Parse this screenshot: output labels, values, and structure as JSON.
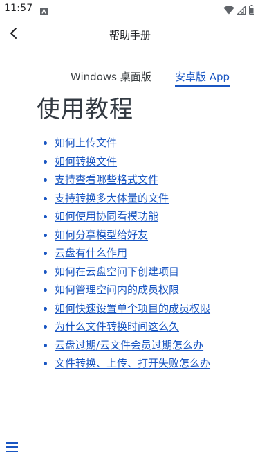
{
  "status_bar": {
    "time": "11:57",
    "notification_icon": "a-badge-icon",
    "wifi_icon": "wifi-icon",
    "signal_icon": "signal-icon",
    "battery_icon": "battery-icon"
  },
  "app_bar": {
    "back_icon": "chevron-left-icon",
    "title": "帮助手册"
  },
  "platform_tabs": {
    "windows_label": "Windows 桌面版",
    "android_label": "安卓版 App",
    "selected": "android"
  },
  "main": {
    "heading": "使用教程",
    "items": [
      {
        "label": "如何上传文件"
      },
      {
        "label": "如何转换文件"
      },
      {
        "label": "支持查看哪些格式文件"
      },
      {
        "label": "支持转换多大体量的文件"
      },
      {
        "label": "如何使用协同看模功能"
      },
      {
        "label": "如何分享模型给好友"
      },
      {
        "label": "云盘有什么作用"
      },
      {
        "label": "如何在云盘空间下创建项目"
      },
      {
        "label": "如何管理空间内的成员权限"
      },
      {
        "label": "如何快速设置单个项目的成员权限"
      },
      {
        "label": "为什么文件转换时间这么久"
      },
      {
        "label": "云盘过期/云文件会员过期怎么办"
      },
      {
        "label": "文件转换、上传、打开失败怎么办"
      }
    ]
  },
  "bottom": {
    "menu_icon": "hamburger-menu-icon"
  },
  "colors": {
    "link": "#1a56c2",
    "heading": "#333a42",
    "text": "#202124"
  }
}
